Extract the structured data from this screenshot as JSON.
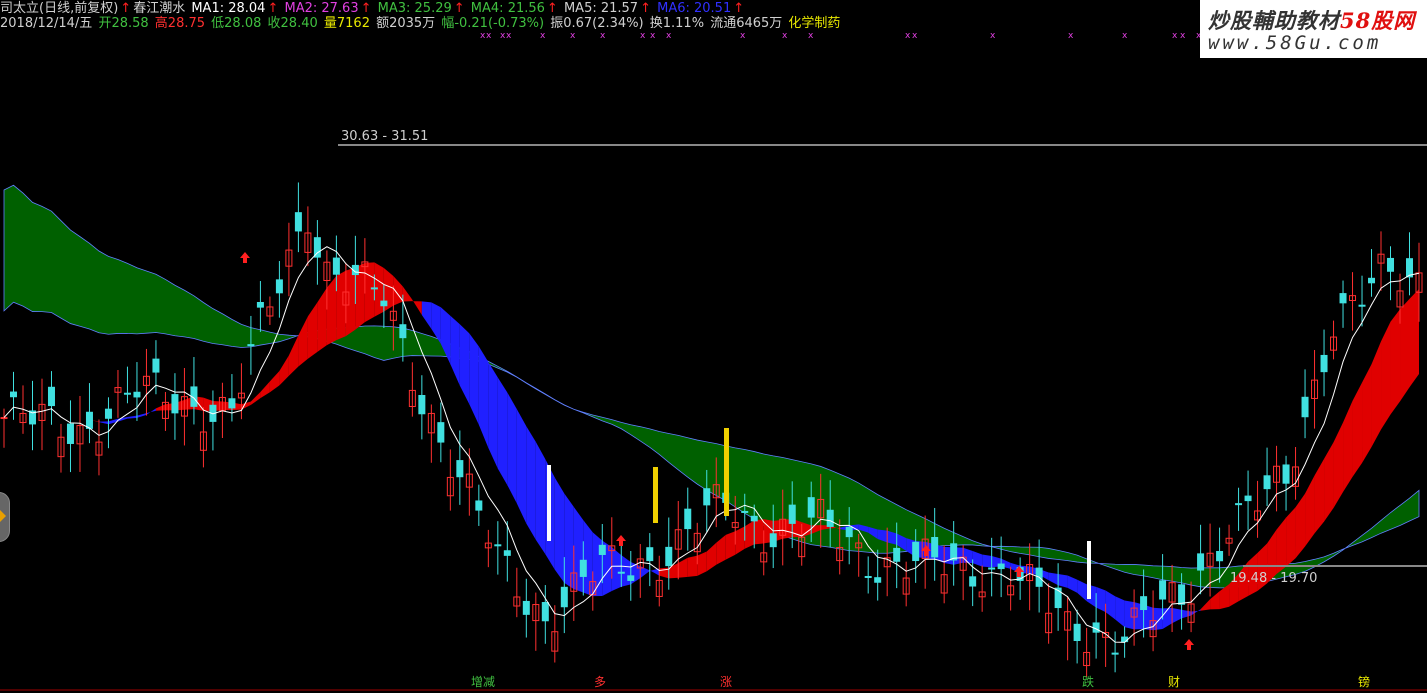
{
  "header": {
    "line1": [
      {
        "text": "司太立(日线,前复权)",
        "color": "#d0d0d0"
      },
      {
        "text": "↑",
        "color": "#ff2020"
      },
      {
        "text": "春江潮水",
        "color": "#d0d0d0"
      },
      {
        "text": "  MA1: 28.04",
        "color": "#ffffff"
      },
      {
        "text": "↑",
        "color": "#ff2020"
      },
      {
        "text": " MA2: 27.63",
        "color": "#e040e0"
      },
      {
        "text": "↑",
        "color": "#ff2020"
      },
      {
        "text": " MA3: 25.29",
        "color": "#40c040"
      },
      {
        "text": "↑",
        "color": "#ff2020"
      },
      {
        "text": " MA4: 21.56",
        "color": "#40c040"
      },
      {
        "text": "↑",
        "color": "#ff2020"
      },
      {
        "text": " MA5: 21.57",
        "color": "#d0d0d0"
      },
      {
        "text": "↑",
        "color": "#ff2020"
      },
      {
        "text": " MA6: 20.51",
        "color": "#3030ff"
      },
      {
        "text": "↑",
        "color": "#ff2020"
      }
    ],
    "line2": [
      {
        "text": "2018/12/14/五",
        "color": "#d0d0d0"
      },
      {
        "text": " 开28.58",
        "color": "#40c040"
      },
      {
        "text": " 高28.75",
        "color": "#ff3030"
      },
      {
        "text": " 低28.08",
        "color": "#40c040"
      },
      {
        "text": " 收28.40",
        "color": "#40c040"
      },
      {
        "text": " 量7162",
        "color": "#e8e800"
      },
      {
        "text": " 额2035万",
        "color": "#d0d0d0"
      },
      {
        "text": " 幅-0.21(-0.73%)",
        "color": "#40c040"
      },
      {
        "text": " 振0.67(2.34%)",
        "color": "#d0d0d0"
      },
      {
        "text": " 换1.11%",
        "color": "#d0d0d0"
      },
      {
        "text": " 流通6465万",
        "color": "#d0d0d0"
      },
      {
        "text": " 化学制药",
        "color": "#e8e800"
      }
    ]
  },
  "logo": {
    "cn_text": "炒股輔助教材",
    "cn_red": "58股网",
    "url": "www.58Gu.com"
  },
  "chart_data": {
    "type": "candlestick",
    "indicator": "春江潮水",
    "ylim": [
      17.5,
      35.5
    ],
    "x_count": 150,
    "marker_labels": [
      {
        "text": "30.63 - 31.51",
        "color": "#d0d0d0"
      },
      {
        "text": "19.48 - 19.70",
        "color": "#d0d0d0"
      }
    ],
    "bottom_labels": [
      {
        "text": "增减",
        "color": "#40c040"
      },
      {
        "text": "多",
        "color": "#ff3030"
      },
      {
        "text": "涨",
        "color": "#ff3030"
      },
      {
        "text": "跌",
        "color": "#40c040"
      },
      {
        "text": "财",
        "color": "#e8e800"
      },
      {
        "text": "镑",
        "color": "#e8e800"
      }
    ],
    "key_points": [
      {
        "x": 0,
        "close": 24.6
      },
      {
        "x": 8,
        "close": 24.3
      },
      {
        "x": 14,
        "close": 25.3
      },
      {
        "x": 24,
        "close": 24.8
      },
      {
        "x": 32,
        "close": 30.5
      },
      {
        "x": 34,
        "close": 28.8
      },
      {
        "x": 40,
        "close": 27.9
      },
      {
        "x": 46,
        "close": 24.0
      },
      {
        "x": 52,
        "close": 20.6
      },
      {
        "x": 57,
        "close": 19.0
      },
      {
        "x": 63,
        "close": 20.3
      },
      {
        "x": 70,
        "close": 20.8
      },
      {
        "x": 76,
        "close": 22.2
      },
      {
        "x": 80,
        "close": 21.5
      },
      {
        "x": 86,
        "close": 21.5
      },
      {
        "x": 92,
        "close": 20.6
      },
      {
        "x": 100,
        "close": 20.3
      },
      {
        "x": 106,
        "close": 20.4
      },
      {
        "x": 112,
        "close": 18.6
      },
      {
        "x": 118,
        "close": 18.6
      },
      {
        "x": 124,
        "close": 19.4
      },
      {
        "x": 129,
        "close": 21.7
      },
      {
        "x": 135,
        "close": 22.6
      },
      {
        "x": 140,
        "close": 27.5
      },
      {
        "x": 145,
        "close": 28.4
      },
      {
        "x": 149,
        "close": 28.4
      }
    ],
    "series": [
      {
        "name": "MA1",
        "value": 28.04,
        "color": "#ffffff"
      },
      {
        "name": "MA2",
        "value": 27.63,
        "color": "#e040e0"
      },
      {
        "name": "MA3",
        "value": 25.29,
        "color": "#40c040"
      },
      {
        "name": "MA4",
        "value": 21.56,
        "color": "#40c040"
      },
      {
        "name": "MA5",
        "value": 21.57,
        "color": "#d0d0d0"
      },
      {
        "name": "MA6",
        "value": 20.51,
        "color": "#3030ff"
      }
    ],
    "colors": {
      "up": "#ff3030",
      "down": "#40e0e0",
      "band_long": "#006000",
      "band_mid_up": "#e00000",
      "band_mid_down": "#2020ff",
      "price_line": "#ffffff",
      "marker_line": "#888888",
      "signal_pink": "#e040e0",
      "arrow": "#ff2020"
    }
  }
}
